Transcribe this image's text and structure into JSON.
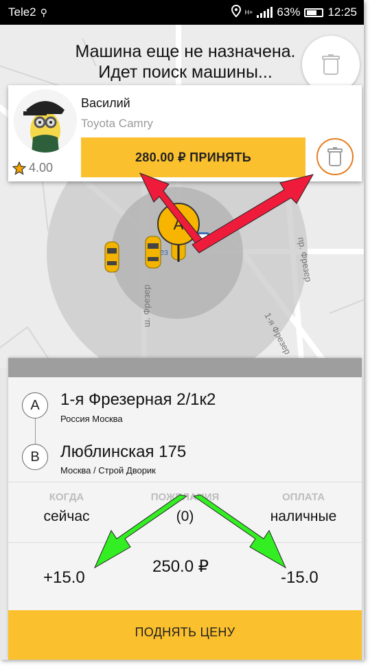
{
  "status_bar": {
    "carrier": "Tele2",
    "network": "H+",
    "battery_percent": "63%",
    "time": "12:25"
  },
  "map": {
    "labels": {
      "street_1": "ш. Фрезер",
      "street_2": "пр. Фрезер",
      "street_3": "1-я Фрезер",
      "poi": "Фрез"
    },
    "pin_letter": "A"
  },
  "header": {
    "line1": "Машина еще не назначена.",
    "line2": "Идет поиск машины..."
  },
  "driver_offer": {
    "name": "Василий",
    "car": "Toyota Camry",
    "rating": "4.00",
    "accept_label": "280.00 ₽ ПРИНЯТЬ"
  },
  "order": {
    "point_a": {
      "badge": "A",
      "address": "1-я Фрезерная  2/1к2",
      "details": "Россия Москва"
    },
    "point_b": {
      "badge": "B",
      "address": "Люблинская 175",
      "details": "Москва  / Строй Дворик"
    },
    "when_label": "КОГДА",
    "when_value": "сейчас",
    "wishes_label": "ПОЖЕЛАНИЯ",
    "wishes_value": "(0)",
    "payment_label": "ОПЛАТА",
    "payment_value": "наличные",
    "price_decrease": "-15.0",
    "price": "250.0 ₽",
    "price_increase": "+15.0",
    "raise_button": "ПОДНЯТЬ ЦЕНУ"
  },
  "colors": {
    "accent_yellow": "#fbc02d",
    "decline_ring": "#e67e22",
    "arrow_red": "#ee1b3a",
    "arrow_green": "#33ee22"
  }
}
